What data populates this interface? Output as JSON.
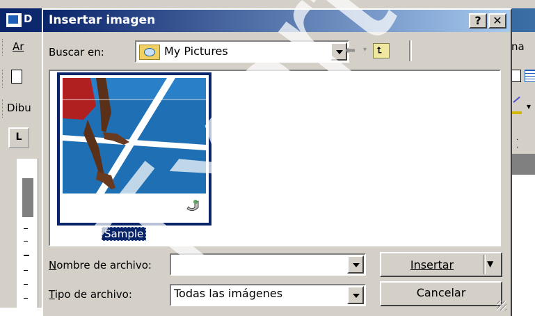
{
  "background_app": {
    "title_letter": "D",
    "menu_partial_left": "Ar",
    "menu_partial_right": "na",
    "drawing_partial": "Dibu",
    "tab_marker": "L"
  },
  "dialog": {
    "title": "Insertar imagen",
    "help_label": "?",
    "close_label": "✕",
    "look_in": {
      "label": "Buscar en:",
      "value": "My Pictures"
    },
    "files": [
      {
        "name": "Sample",
        "selected": true
      }
    ],
    "file_name": {
      "label": "Nombre de archivo:",
      "value": ""
    },
    "file_type": {
      "label": "Tipo de archivo:",
      "value": "Todas las imágenes"
    },
    "insert_button": "Insertar",
    "cancel_button": "Cancelar"
  },
  "watermark": "Txarte",
  "colors": {
    "titlebar_start": "#0a246a",
    "titlebar_end": "#a6caf0",
    "face": "#d4d0c8",
    "selection": "#0a246a"
  }
}
